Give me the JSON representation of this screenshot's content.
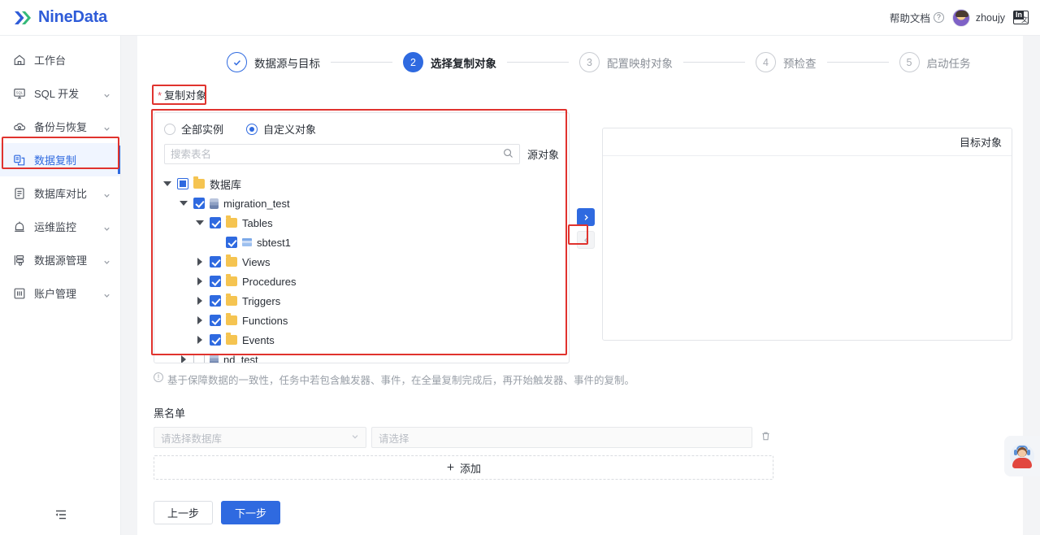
{
  "app": {
    "brand": "NineData",
    "logo_icon": "ninedata-logo-icon"
  },
  "topbar": {
    "help_label": "帮助文档",
    "help_icon": "question-circle-icon",
    "user_name": "zhoujy",
    "avatar_icon": "user-avatar",
    "lang_label": "语言切换",
    "lang_icon": "language-switch-icon"
  },
  "sidebar": {
    "items": [
      {
        "label": "工作台",
        "icon": "home-icon",
        "expandable": false,
        "active": false
      },
      {
        "label": "SQL 开发",
        "icon": "monitor-sql-icon",
        "expandable": true,
        "active": false
      },
      {
        "label": "备份与恢复",
        "icon": "cloud-backup-icon",
        "expandable": true,
        "active": false
      },
      {
        "label": "数据复制",
        "icon": "data-copy-icon",
        "expandable": false,
        "active": true
      },
      {
        "label": "数据库对比",
        "icon": "compare-icon",
        "expandable": true,
        "active": false
      },
      {
        "label": "运维监控",
        "icon": "monitor-alarm-icon",
        "expandable": true,
        "active": false
      },
      {
        "label": "数据源管理",
        "icon": "datasource-icon",
        "expandable": true,
        "active": false
      },
      {
        "label": "账户管理",
        "icon": "account-icon",
        "expandable": true,
        "active": false
      }
    ],
    "collapse_icon": "collapse-sidebar-icon"
  },
  "steps": [
    {
      "num": "1",
      "label": "数据源与目标",
      "state": "done"
    },
    {
      "num": "2",
      "label": "选择复制对象",
      "state": "current"
    },
    {
      "num": "3",
      "label": "配置映射对象",
      "state": "pending"
    },
    {
      "num": "4",
      "label": "预检查",
      "state": "pending"
    },
    {
      "num": "5",
      "label": "启动任务",
      "state": "pending"
    }
  ],
  "form": {
    "copy_object_label": "复制对象",
    "required_mark": "*",
    "radios": [
      {
        "label": "全部实例",
        "selected": false
      },
      {
        "label": "自定义对象",
        "selected": true
      }
    ],
    "search": {
      "placeholder": "搜索表名",
      "value": "",
      "icon": "search-icon"
    },
    "source_panel_title": "源对象",
    "target_panel_title": "目标对象",
    "transfer": {
      "to_right_icon": "chevron-right-icon",
      "to_left_icon": "chevron-left-icon",
      "to_right_enabled": true,
      "to_left_enabled": false
    },
    "tree": [
      {
        "label": "数据库",
        "icon": "folder-icon",
        "indent": 0,
        "check": "mixed",
        "caret": "down",
        "selected_text": "数据库"
      },
      {
        "label": "migration_test",
        "icon": "database-icon",
        "indent": 1,
        "check": "checked",
        "caret": "down"
      },
      {
        "label": "Tables",
        "icon": "folder-icon",
        "indent": 2,
        "check": "checked",
        "caret": "down"
      },
      {
        "label": "sbtest1",
        "icon": "table-icon",
        "indent": 3,
        "check": "checked",
        "caret": "none"
      },
      {
        "label": "Views",
        "icon": "folder-icon",
        "indent": 2,
        "check": "checked",
        "caret": "right"
      },
      {
        "label": "Procedures",
        "icon": "folder-icon",
        "indent": 2,
        "check": "checked",
        "caret": "right"
      },
      {
        "label": "Triggers",
        "icon": "folder-icon",
        "indent": 2,
        "check": "checked",
        "caret": "right"
      },
      {
        "label": "Functions",
        "icon": "folder-icon",
        "indent": 2,
        "check": "checked",
        "caret": "right"
      },
      {
        "label": "Events",
        "icon": "folder-icon",
        "indent": 2,
        "check": "checked",
        "caret": "right"
      },
      {
        "label": "nd_test",
        "icon": "database-icon",
        "indent": 1,
        "check": "unchecked",
        "caret": "right"
      }
    ],
    "hint": {
      "icon": "info-circle-icon",
      "text": "基于保障数据的一致性，任务中若包含触发器、事件，在全量复制完成后，再开始触发器、事件的复制。"
    },
    "blacklist": {
      "label": "黑名单",
      "db_placeholder": "请选择数据库",
      "db_value": "",
      "obj_placeholder": "请选择",
      "obj_value": "",
      "delete_icon": "trash-icon",
      "dropdown_icon": "chevron-down-icon",
      "add_label": "添加",
      "add_icon": "plus-icon"
    }
  },
  "footer": {
    "prev_label": "上一步",
    "next_label": "下一步"
  },
  "chat": {
    "icon": "customer-service-icon",
    "label": "在线客服"
  }
}
